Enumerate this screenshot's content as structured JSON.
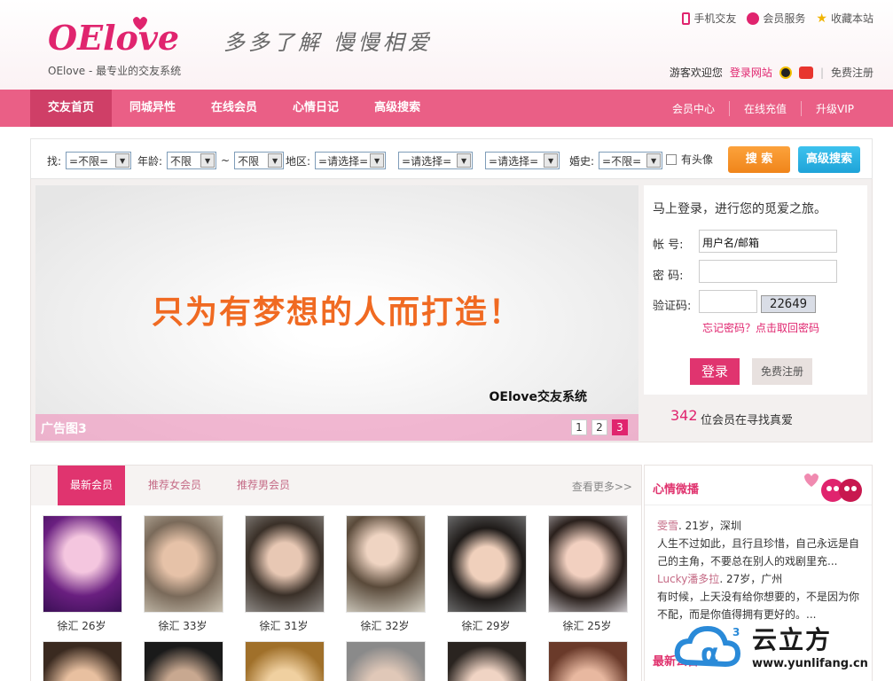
{
  "header": {
    "logo": "OElove",
    "tagline": "OElove - 最专业的交友系统",
    "slogan": "多多了解 慢慢相爱",
    "top_links": [
      "手机交友",
      "会员服务",
      "收藏本站"
    ],
    "welcome_text": "游客欢迎您",
    "login_link": "登录网站",
    "register_link": "免费注册"
  },
  "nav": {
    "left": [
      "交友首页",
      "同城异性",
      "在线会员",
      "心情日记",
      "高级搜索"
    ],
    "right": [
      "会员中心",
      "在线充值",
      "升级VIP"
    ]
  },
  "search": {
    "find_label": "找:",
    "find_value": "=不限=",
    "age_label": "年龄:",
    "age_from": "不限",
    "age_sep": "~",
    "age_to": "不限",
    "region_label": "地区:",
    "region1": "=请选择=",
    "region2": "=请选择=",
    "region3": "=请选择=",
    "marriage_label": "婚史:",
    "marriage_value": "=不限=",
    "avatar_label": "有头像",
    "search_button": "搜 索",
    "advanced_button": "高级搜索"
  },
  "banner": {
    "headline": "只为有梦想的人而打造！",
    "brand": "OElove交友系统",
    "caption": "广告图3",
    "pages": [
      "1",
      "2",
      "3"
    ],
    "active_page": "3"
  },
  "login": {
    "title": "马上登录，进行您的觅爱之旅。",
    "account_label": "帐 号:",
    "account_value": "用户名/邮箱",
    "password_label": "密 码:",
    "captcha_label": "验证码:",
    "captcha_code": "22649",
    "forgot": "忘记密码？点击取回密码",
    "login_button": "登录",
    "register_button": "免费注册",
    "member_count": "342",
    "member_count_text": "位会员在寻找真爱"
  },
  "members": {
    "tabs": [
      "最新会员",
      "推荐女会员",
      "推荐男会员"
    ],
    "more": "查看更多>>",
    "list": [
      {
        "caption": "徐汇 26岁"
      },
      {
        "caption": "徐汇 33岁"
      },
      {
        "caption": "徐汇 31岁"
      },
      {
        "caption": "徐汇 32岁"
      },
      {
        "caption": "徐汇 29岁"
      },
      {
        "caption": "徐汇 25岁"
      }
    ]
  },
  "weibo": {
    "title": "心情微播",
    "posts": [
      {
        "user": "雯雪",
        "meta": ". 21岁，深圳",
        "text": "人生不过如此，且行且珍惜，自己永远是自己的主角，不要总在别人的戏剧里充..."
      },
      {
        "user": "Lucky潘多拉",
        "meta": ". 27岁，广州",
        "text": "有时候，上天没有给你想要的，不是因为你不配，而是你值得拥有更好的。..."
      }
    ],
    "next_title": "最新公告"
  },
  "watermark": {
    "name": "云立方",
    "url": "www.yunlifang.cn"
  },
  "colors": {
    "brand_pink": "#e0346f",
    "nav_pink": "#ea5f86",
    "search_orange": "#f0851a",
    "search_blue": "#1ea3d8"
  }
}
